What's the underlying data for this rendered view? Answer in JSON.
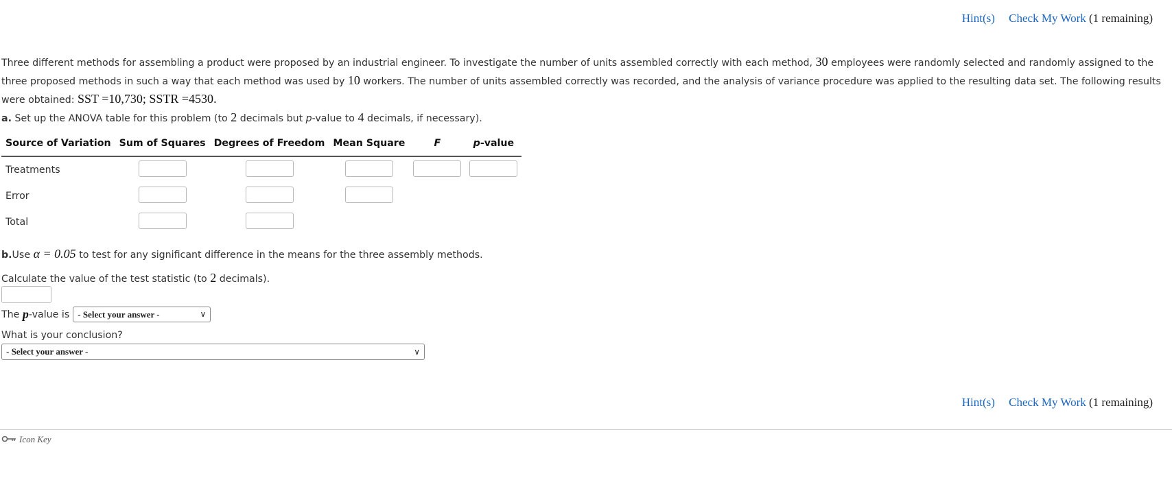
{
  "header": {
    "hints": "Hint(s)",
    "check": "Check My Work",
    "remaining": "(1 remaining)"
  },
  "intro": {
    "s1": "Three different methods for assembling a product were proposed by an industrial engineer. To investigate the number of units assembled correctly with each method,",
    "n30": "30",
    "s2": "employees were randomly selected and randomly assigned to the three proposed methods in such a way that each method was used by",
    "n10": "10",
    "s3": "workers. The number of units assembled correctly was recorded, and the analysis of variance procedure was applied to the resulting data set. The following results were obtained:",
    "sst": "SST =10,730",
    "sep": ";",
    "sstr": "SSTR =4530",
    "end": "."
  },
  "partA": {
    "label": "a.",
    "t1": "Set up the ANOVA table for this problem (to",
    "n2": "2",
    "t2": "decimals but",
    "p": "p",
    "t3": "-value to",
    "n4": "4",
    "t4": "decimals, if necessary)."
  },
  "table": {
    "headers": {
      "source": "Source of Variation",
      "ss": "Sum of Squares",
      "df": "Degrees of Freedom",
      "ms": "Mean Square",
      "f": "F",
      "p": "p",
      "pvalue_suffix": "-value"
    },
    "rows": {
      "treatments": "Treatments",
      "error": "Error",
      "total": "Total"
    }
  },
  "partB": {
    "label": "b.",
    "use": "Use",
    "alpha": "α = 0.05",
    "rest": "to test for any significant difference in the means for the three assembly methods.",
    "calc1": "Calculate the value of the test statistic (to",
    "calc_n": "2",
    "calc2": "decimals).",
    "pv1": "The",
    "pv_p": "p",
    "pv2": "-value is",
    "pv_select": "- Select your answer -",
    "conclusion_q": "What is your conclusion?",
    "conclusion_select": "- Select your answer -"
  },
  "footer": {
    "iconkey": "Icon Key"
  }
}
